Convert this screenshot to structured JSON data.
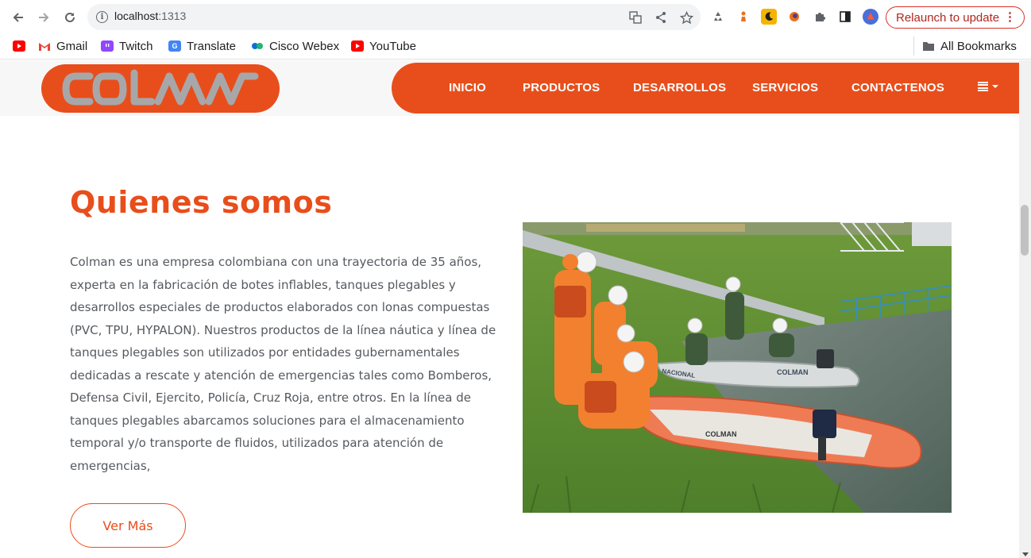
{
  "browser": {
    "url_host": "localhost",
    "url_port": ":1313",
    "relaunch_label": "Relaunch to update",
    "relaunch_menu": "⋮",
    "bookmarks": [
      {
        "label": "",
        "icon": "youtube-icon",
        "color": "#ff0000"
      },
      {
        "label": "Gmail",
        "icon": "gmail-icon",
        "color": "#ea4335"
      },
      {
        "label": "Twitch",
        "icon": "twitch-icon",
        "color": "#9146ff"
      },
      {
        "label": "Translate",
        "icon": "translate-icon",
        "color": "#4285f4"
      },
      {
        "label": "Cisco Webex",
        "icon": "webex-icon",
        "color": "#0f6fd8"
      },
      {
        "label": "YouTube",
        "icon": "youtube-icon",
        "color": "#ff0000"
      }
    ],
    "all_bookmarks_label": "All Bookmarks"
  },
  "site": {
    "logo_text": "COLMAN",
    "brand_color": "#e84e1b",
    "nav": [
      "INICIO",
      "PRODUCTOS",
      "DESARROLLOS",
      "SERVICIOS",
      "CONTACTENOS"
    ]
  },
  "about": {
    "title": "Quienes somos",
    "body": "Colman es una empresa colombiana con una trayectoria de 35 años, experta en la fabricación de botes inflables, tanques plegables y desarrollos especiales de productos elaborados con lonas compuestas (PVC, TPU, HYPALON). Nuestros productos de la línea náutica y línea de tanques plegables son utilizados por entidades gubernamentales dedicadas a rescate y atención de emergencias tales como Bomberos, Defensa Civil, Ejercito, Policía, Cruz Roja, entre otros. En la línea de tanques plegables abarcamos soluciones para el almacenamiento temporal y/o transporte de fluidos, utilizados para atención de emergencias,",
    "button_label": "Ver Más",
    "photo_boat_label_1": "COLMAN",
    "photo_boat_label_2": "NACIONAL"
  }
}
